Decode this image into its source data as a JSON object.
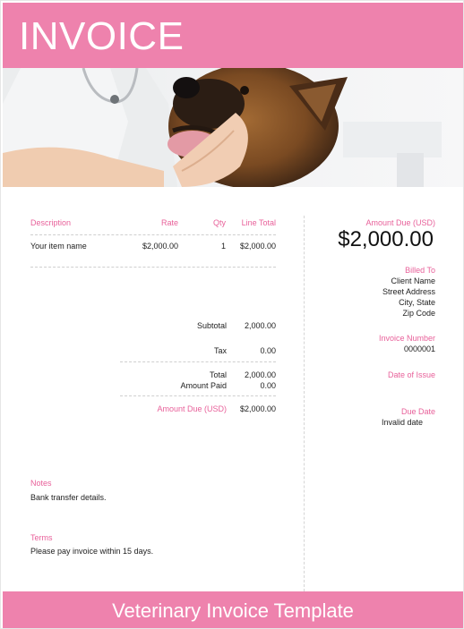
{
  "header": {
    "title": "INVOICE"
  },
  "table": {
    "headers": {
      "description": "Description",
      "rate": "Rate",
      "qty": "Qty",
      "line_total": "Line Total"
    },
    "rows": [
      {
        "description": "Your item name",
        "rate": "$2,000.00",
        "qty": "1",
        "line_total": "$2,000.00"
      }
    ]
  },
  "totals": {
    "subtotal_label": "Subtotal",
    "subtotal_value": "2,000.00",
    "tax_label": "Tax",
    "tax_value": "0.00",
    "total_label": "Total",
    "total_value": "2,000.00",
    "paid_label": "Amount Paid",
    "paid_value": "0.00",
    "due_label": "Amount Due (USD)",
    "due_value": "$2,000.00"
  },
  "notes": {
    "label": "Notes",
    "text": "Bank transfer details."
  },
  "terms": {
    "label": "Terms",
    "text": "Please pay invoice within 15 days."
  },
  "sidebar": {
    "amount_due_label": "Amount Due (USD)",
    "amount_due_value": "$2,000.00",
    "billed_to_label": "Billed To",
    "billed_to_lines": [
      "Client Name",
      "Street Address",
      "City, State",
      "Zip Code"
    ],
    "invoice_number_label": "Invoice Number",
    "invoice_number_value": "0000001",
    "date_of_issue_label": "Date of Issue",
    "due_date_label": "Due Date",
    "due_date_value": "Invalid date"
  },
  "footer": {
    "title": "Veterinary Invoice Template"
  },
  "colors": {
    "accent": "#ee82ad",
    "accent_text": "#e8619a"
  }
}
